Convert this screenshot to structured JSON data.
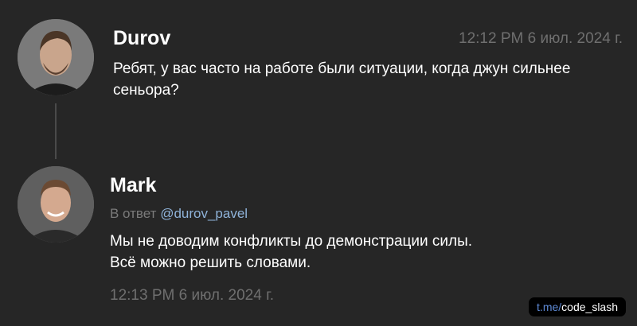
{
  "posts": [
    {
      "author": "Durov",
      "timestamp": "12:12 PM 6 июл. 2024 г.",
      "lines": [
        "Ребят, у вас часто на работе были ситуации, когда джун сильнее",
        "сеньора?"
      ]
    },
    {
      "author": "Mark",
      "reply_prefix": "В ответ",
      "reply_handle": "@durov_pavel",
      "lines": [
        "Мы не доводим конфликты до демонстрации силы.",
        "Всё можно решить словами."
      ],
      "timestamp": "12:13 PM 6 июл. 2024 г."
    }
  ],
  "watermark": {
    "domain": "t.me/",
    "channel": "code_slash"
  },
  "colors": {
    "background": "#262626",
    "handle": "#8fb3d9",
    "timestamp": "#6f6f6f"
  }
}
